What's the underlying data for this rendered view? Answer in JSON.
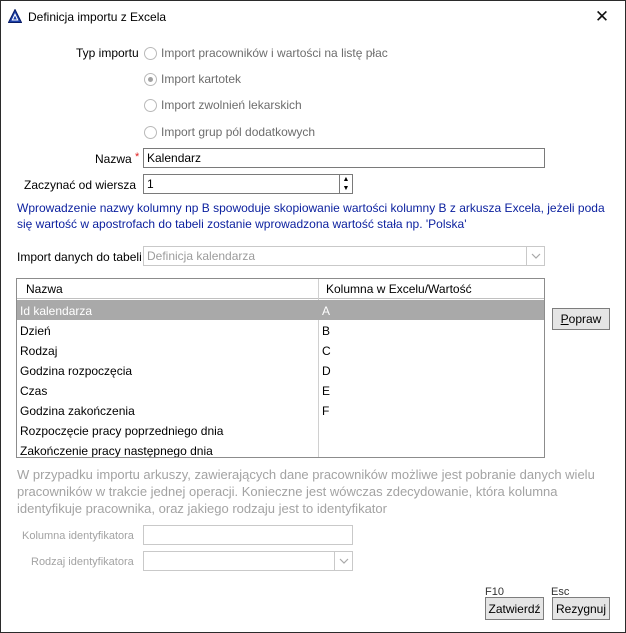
{
  "window": {
    "title": "Definicja importu z Excela",
    "close_glyph": "✕"
  },
  "form": {
    "typ_importu_label": "Typ importu",
    "options": [
      {
        "label": "Import pracowników i wartości na listę płac",
        "checked": false
      },
      {
        "label": "Import kartotek",
        "checked": true
      },
      {
        "label": "Import zwolnień lekarskich",
        "checked": false
      },
      {
        "label": "Import grup pól dodatkowych",
        "checked": false
      }
    ],
    "nazwa_label": "Nazwa",
    "required_mark": "*",
    "nazwa_value": "Kalendarz",
    "start_row_label": "Zaczynać od wiersza",
    "start_row_value": "1",
    "spin_up": "▲",
    "spin_down": "▼",
    "info_text": "Wprowadzenie nazwy kolumny np B spowoduje skopiowanie wartości kolumny B z arkusza Excela, jeżeli poda się wartość w apostrofach do tabeli zostanie wprowadzona wartość stała np. 'Polska'",
    "table_label": "Import danych do tabeli",
    "table_value": "Definicja kalendarza",
    "dropdown_glyph": "⌵"
  },
  "grid": {
    "headers": [
      "Nazwa",
      "Kolumna w Excelu/Wartość"
    ],
    "rows": [
      {
        "name": "Id kalendarza",
        "col": "A",
        "selected": true
      },
      {
        "name": "Dzień",
        "col": "B",
        "selected": false
      },
      {
        "name": "Rodzaj",
        "col": "C",
        "selected": false
      },
      {
        "name": "Godzina rozpoczęcia",
        "col": "D",
        "selected": false
      },
      {
        "name": "Czas",
        "col": "E",
        "selected": false
      },
      {
        "name": "Godzina zakończenia",
        "col": "F",
        "selected": false
      },
      {
        "name": "Rozpoczęcie pracy poprzedniego dnia",
        "col": "",
        "selected": false
      },
      {
        "name": "Zakończenie pracy następnego dnia",
        "col": "",
        "selected": false
      }
    ]
  },
  "buttons": {
    "popraw": "Popraw",
    "popraw_mnemonic": "P",
    "popraw_rest": "opraw",
    "zatwierdz": "Zatwierdź",
    "rezygnuj": "Rezygnuj",
    "f10": "F10",
    "esc": "Esc"
  },
  "employees": {
    "note": "W przypadku importu arkuszy, zawierających dane pracowników możliwe jest pobranie danych wielu pracowników w trakcie jednej operacji. Konieczne jest wówczas zdecydowanie, która kolumna identyfikuje pracownika, oraz jakiego rodzaju jest to identyfikator",
    "id_column_label": "Kolumna identyfikatora",
    "id_column_value": "",
    "id_type_label": "Rodzaj identyfikatora",
    "id_type_value": ""
  }
}
